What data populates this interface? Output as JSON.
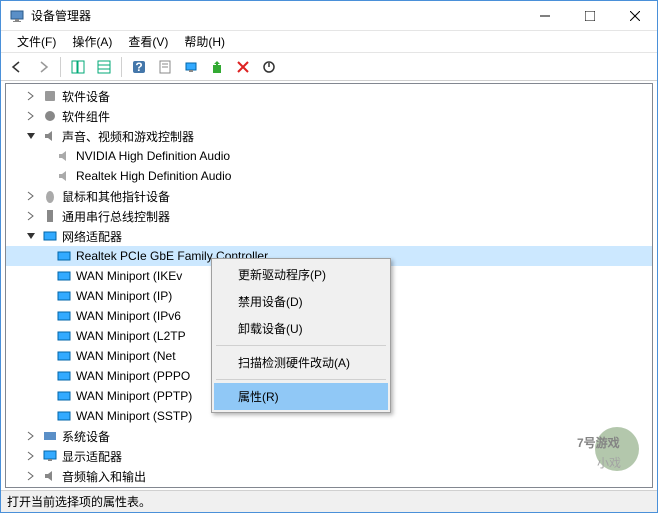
{
  "window": {
    "title": "设备管理器"
  },
  "menu": {
    "file": "文件(F)",
    "action": "操作(A)",
    "view": "查看(V)",
    "help": "帮助(H)"
  },
  "tree": {
    "software_devices": "软件设备",
    "software_components": "软件组件",
    "sound_video_game": "声音、视频和游戏控制器",
    "nvidia_audio": "NVIDIA High Definition Audio",
    "realtek_audio": "Realtek High Definition Audio",
    "mouse_pointing": "鼠标和其他指针设备",
    "usb_controllers": "通用串行总线控制器",
    "network_adapters": "网络适配器",
    "realtek_gbe": "Realtek PCIe GbE Family Controller",
    "wan_ikev": "WAN Miniport (IKEv",
    "wan_ip": "WAN Miniport (IP)",
    "wan_ipv6": "WAN Miniport (IPv6",
    "wan_l2tp": "WAN Miniport (L2TP",
    "wan_net": "WAN Miniport (Net",
    "wan_pppo": "WAN Miniport (PPPO",
    "wan_pptp": "WAN Miniport (PPTP)",
    "wan_sstp": "WAN Miniport (SSTP)",
    "system_devices": "系统设备",
    "display_adapters": "显示适配器",
    "audio_io": "音频输入和输出"
  },
  "context_menu": {
    "update_driver": "更新驱动程序(P)",
    "disable_device": "禁用设备(D)",
    "uninstall_device": "卸载设备(U)",
    "scan_hardware": "扫描检测硬件改动(A)",
    "properties": "属性(R)"
  },
  "statusbar": {
    "text": "打开当前选择项的属性表。"
  },
  "watermark": {
    "line1": "7号游戏",
    "line2": "小戏"
  }
}
